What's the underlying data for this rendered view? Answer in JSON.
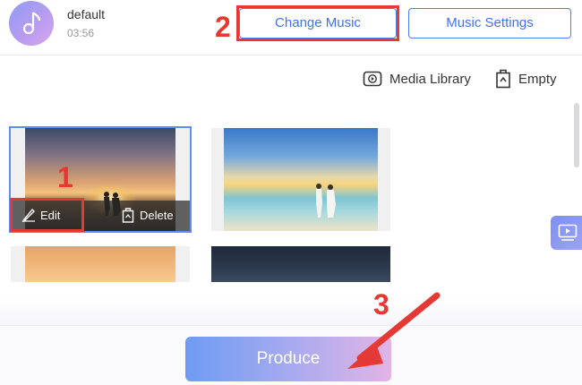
{
  "header": {
    "track_name": "default",
    "track_duration": "03:56",
    "change_music_label": "Change Music",
    "music_settings_label": "Music Settings"
  },
  "toolbar": {
    "media_library_label": "Media Library",
    "empty_label": "Empty"
  },
  "thumbnail": {
    "edit_label": "Edit",
    "delete_label": "Delete"
  },
  "footer": {
    "produce_label": "Produce"
  },
  "annotations": {
    "step_1": "1",
    "step_2": "2",
    "step_3": "3",
    "color": "#e53935"
  },
  "colors": {
    "accent_blue": "#4a7cf2",
    "produce_gradient_start": "#6e9bf3",
    "produce_gradient_end": "#e2b4e4"
  },
  "icons": [
    "music-note-icon",
    "media-library-icon",
    "trash-icon",
    "pencil-icon",
    "preview-icon"
  ]
}
